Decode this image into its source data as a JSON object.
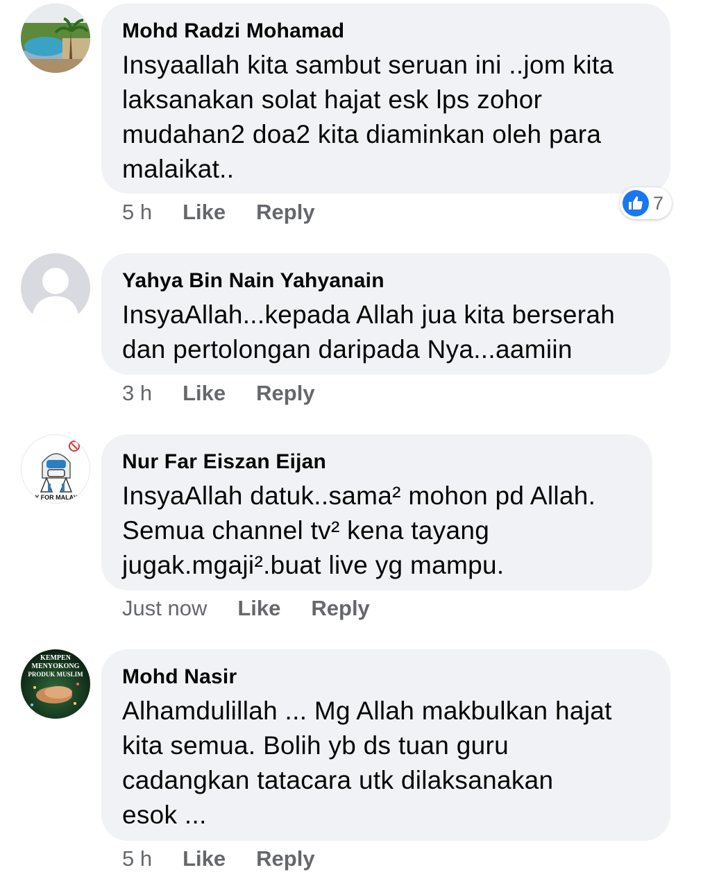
{
  "colors": {
    "bubble": "#f0f2f5",
    "meta_text": "#65676b",
    "like_blue": "#1877f2"
  },
  "comments": [
    {
      "author": "Mohd Radzi Mohamad",
      "lines": [
        "Insyaallah kita sambut seruan ini ..jom kita",
        "laksanakan solat hajat esk lps zohor",
        "mudahan2 doa2 kita diaminkan oleh para",
        "malaikat.."
      ],
      "time": "5 h",
      "like_label": "Like",
      "reply_label": "Reply",
      "reactions": {
        "icon": "thumbs-up-icon",
        "count": "7"
      },
      "avatar_icon": "pool-photo-avatar"
    },
    {
      "author": "Yahya Bin Nain Yahyanain",
      "lines": [
        "InsyaAllah...kepada Allah jua kita berserah",
        "dan pertolongan daripada Nya...aamiin"
      ],
      "time": "3 h",
      "like_label": "Like",
      "reply_label": "Reply",
      "avatar_icon": "default-silhouette-avatar"
    },
    {
      "author": "Nur Far Eiszan Eijan",
      "lines": [
        "InsyaAllah datuk..sama² mohon pd Allah.",
        "Semua channel tv² kena tayang",
        "jugak.mgaji².buat live yg mampu."
      ],
      "time": "Just now",
      "like_label": "Like",
      "reply_label": "Reply",
      "avatar_icon": "pray-for-malaysia-avatar",
      "avatar_text": "AY FOR MALAYS"
    },
    {
      "author": "Mohd Nasir",
      "lines": [
        "Alhamdulillah ... Mg Allah makbulkan hajat",
        "kita semua. Bolih yb ds tuan guru",
        "cadangkan tatacara utk dilaksanakan",
        "esok ..."
      ],
      "time": "5 h",
      "like_label": "Like",
      "reply_label": "Reply",
      "avatar_icon": "kempen-produk-muslim-avatar",
      "avatar_text": [
        "KEMPEN",
        "MENYOKONG",
        "PRODUK MUSLIM"
      ]
    }
  ]
}
